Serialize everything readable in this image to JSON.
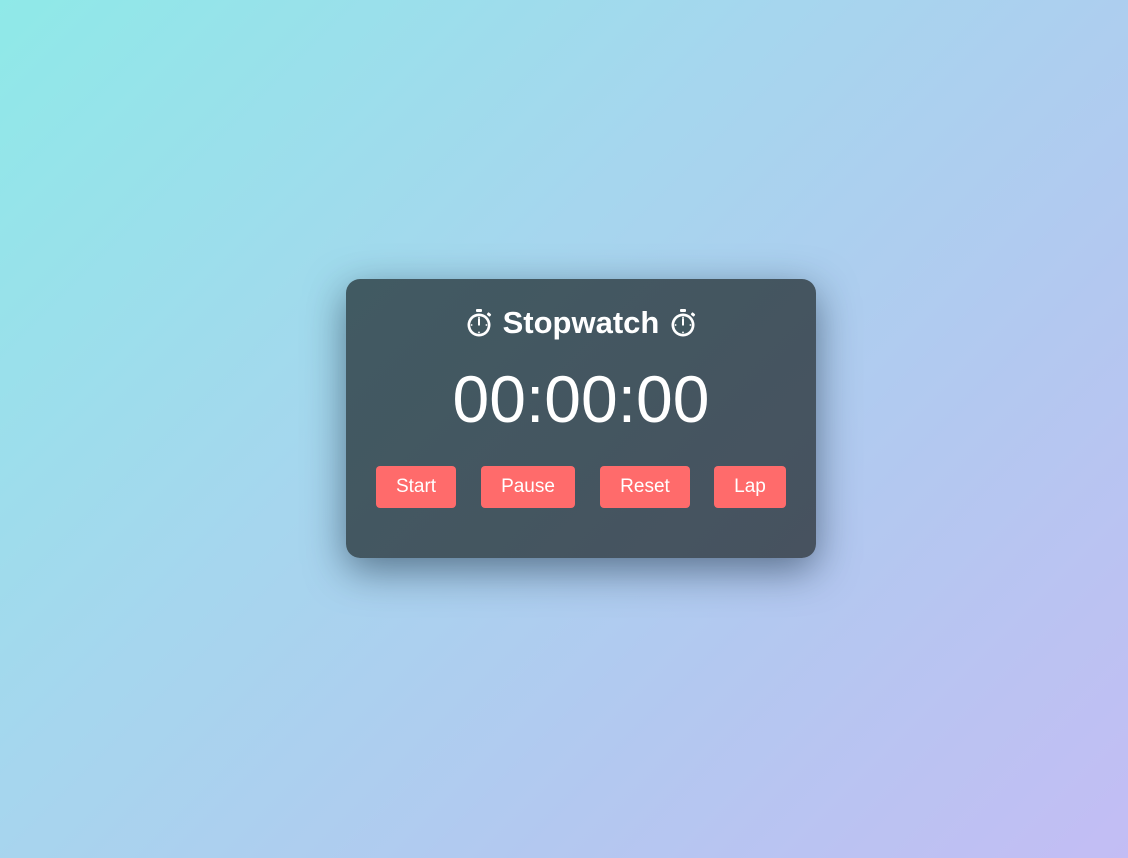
{
  "stopwatch": {
    "title": "Stopwatch",
    "title_icon": "stopwatch-icon",
    "time": "00:00:00",
    "buttons": {
      "start": "Start",
      "pause": "Pause",
      "reset": "Reset",
      "lap": "Lap"
    }
  },
  "colors": {
    "background_start": "#8fe9e8",
    "background_end": "#c3bdf4",
    "card": "#445660",
    "button": "#ff6b6b",
    "text": "#ffffff"
  }
}
